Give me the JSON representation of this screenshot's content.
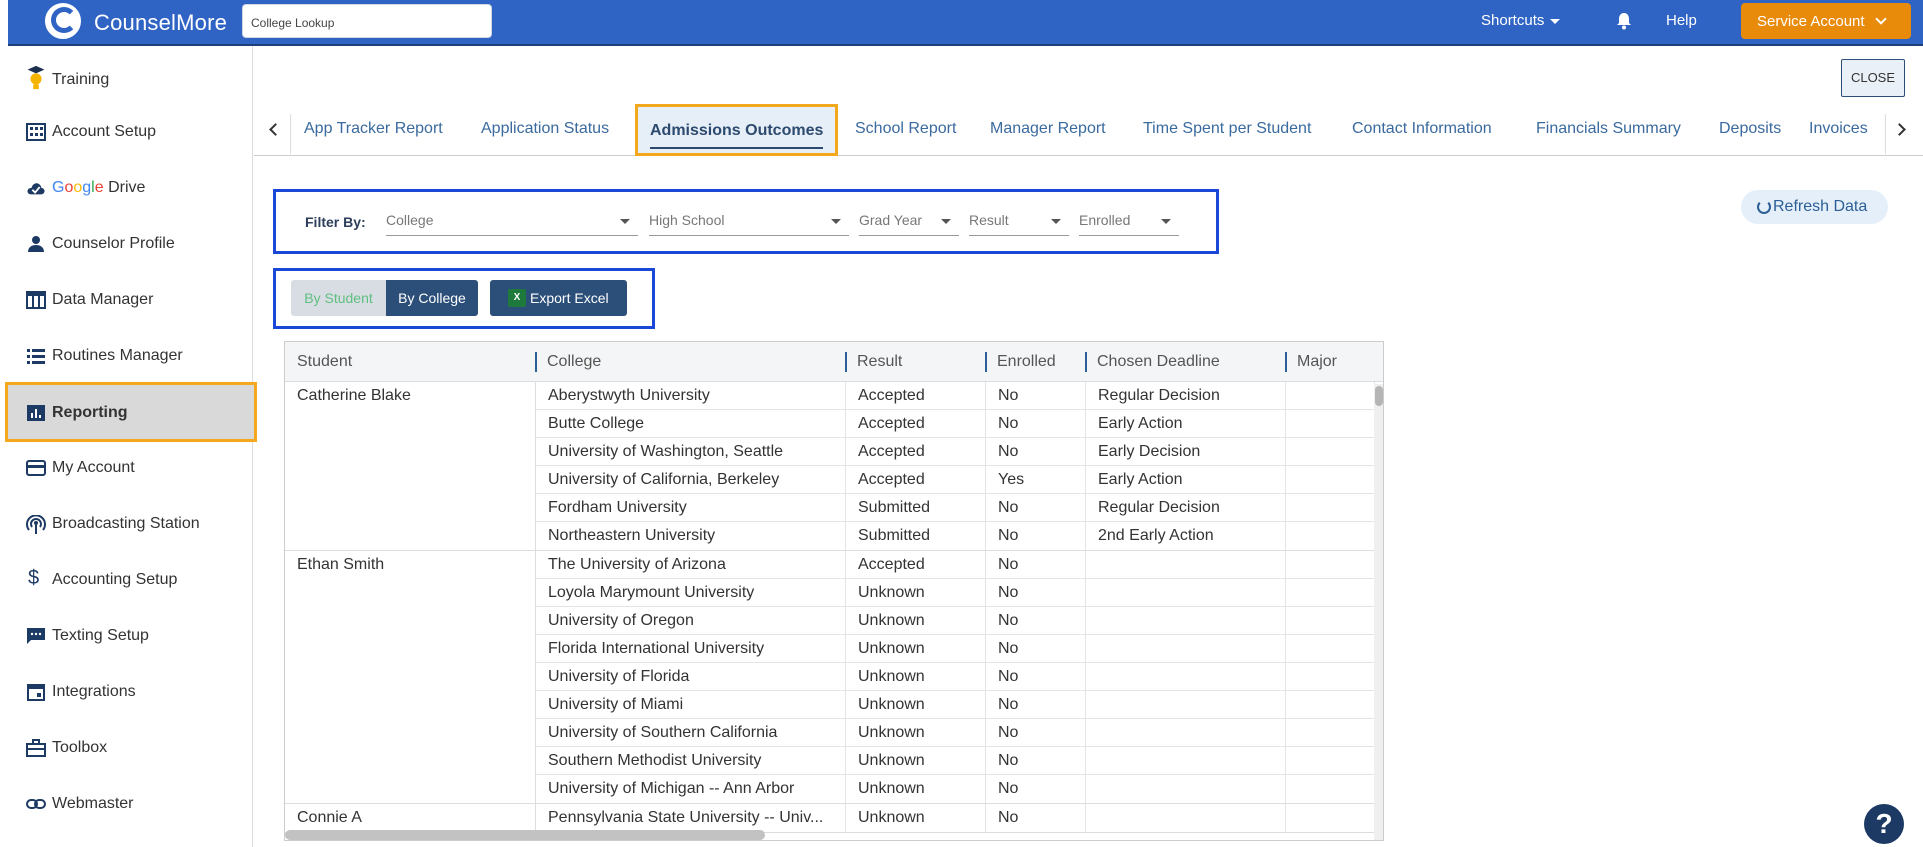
{
  "header": {
    "brand": "CounselMore",
    "search_value": "College Lookup",
    "shortcuts_label": "Shortcuts",
    "help_label": "Help",
    "account_label": "Service Account"
  },
  "sidebar": {
    "items": [
      {
        "label": "Training",
        "icon": "graduation-bulb-icon"
      },
      {
        "label": "Account Setup",
        "icon": "building-icon"
      },
      {
        "label": "Drive",
        "prefix": "Google",
        "icon": "cloud-check-icon"
      },
      {
        "label": "Counselor Profile",
        "icon": "person-icon"
      },
      {
        "label": "Data Manager",
        "icon": "table-icon"
      },
      {
        "label": "Routines Manager",
        "icon": "list-icon"
      },
      {
        "label": "Reporting",
        "icon": "bar-chart-icon",
        "active": true
      },
      {
        "label": "My Account",
        "icon": "credit-card-icon"
      },
      {
        "label": "Broadcasting Station",
        "icon": "broadcast-icon"
      },
      {
        "label": "Accounting Setup",
        "icon": "dollar-icon"
      },
      {
        "label": "Texting Setup",
        "icon": "chat-icon"
      },
      {
        "label": "Integrations",
        "icon": "calendar-icon"
      },
      {
        "label": "Toolbox",
        "icon": "toolbox-icon"
      },
      {
        "label": "Webmaster",
        "icon": "link-icon"
      }
    ]
  },
  "main": {
    "close_label": "CLOSE",
    "tabs": [
      {
        "label": "App Tracker Report"
      },
      {
        "label": "Application Status"
      },
      {
        "label": "Admissions Outcomes",
        "active": true
      },
      {
        "label": "School Report"
      },
      {
        "label": "Manager Report"
      },
      {
        "label": "Time Spent per Student"
      },
      {
        "label": "Contact Information"
      },
      {
        "label": "Financials Summary"
      },
      {
        "label": "Deposits"
      },
      {
        "label": "Invoices"
      }
    ],
    "filter": {
      "label": "Filter By:",
      "dropdowns": [
        {
          "placeholder": "College"
        },
        {
          "placeholder": "High School"
        },
        {
          "placeholder": "Grad Year"
        },
        {
          "placeholder": "Result"
        },
        {
          "placeholder": "Enrolled"
        }
      ]
    },
    "refresh_label": "Refresh Data",
    "view_toggle": {
      "by_student": "By Student",
      "by_college": "By College"
    },
    "export_label": "Export Excel"
  },
  "table": {
    "columns": [
      "Student",
      "College",
      "Result",
      "Enrolled",
      "Chosen Deadline",
      "Major"
    ],
    "groups": [
      {
        "student": "Catherine Blake",
        "rows": [
          {
            "college": "Aberystwyth University",
            "result": "Accepted",
            "enrolled": "No",
            "deadline": "Regular Decision",
            "major": ""
          },
          {
            "college": "Butte College",
            "result": "Accepted",
            "enrolled": "No",
            "deadline": "Early Action",
            "major": ""
          },
          {
            "college": "University of Washington, Seattle",
            "result": "Accepted",
            "enrolled": "No",
            "deadline": "Early Decision",
            "major": ""
          },
          {
            "college": "University of California, Berkeley",
            "result": "Accepted",
            "enrolled": "Yes",
            "deadline": "Early Action",
            "major": ""
          },
          {
            "college": "Fordham University",
            "result": "Submitted",
            "enrolled": "No",
            "deadline": "Regular Decision",
            "major": ""
          },
          {
            "college": "Northeastern University",
            "result": "Submitted",
            "enrolled": "No",
            "deadline": "2nd Early Action",
            "major": ""
          }
        ]
      },
      {
        "student": "Ethan Smith",
        "rows": [
          {
            "college": "The University of Arizona",
            "result": "Accepted",
            "enrolled": "No",
            "deadline": "",
            "major": ""
          },
          {
            "college": "Loyola Marymount University",
            "result": "Unknown",
            "enrolled": "No",
            "deadline": "",
            "major": ""
          },
          {
            "college": "University of Oregon",
            "result": "Unknown",
            "enrolled": "No",
            "deadline": "",
            "major": ""
          },
          {
            "college": "Florida International University",
            "result": "Unknown",
            "enrolled": "No",
            "deadline": "",
            "major": ""
          },
          {
            "college": "University of Florida",
            "result": "Unknown",
            "enrolled": "No",
            "deadline": "",
            "major": ""
          },
          {
            "college": "University of Miami",
            "result": "Unknown",
            "enrolled": "No",
            "deadline": "",
            "major": ""
          },
          {
            "college": "University of Southern California",
            "result": "Unknown",
            "enrolled": "No",
            "deadline": "",
            "major": ""
          },
          {
            "college": "Southern Methodist University",
            "result": "Unknown",
            "enrolled": "No",
            "deadline": "",
            "major": ""
          },
          {
            "college": "University of Michigan -- Ann Arbor",
            "result": "Unknown",
            "enrolled": "No",
            "deadline": "",
            "major": ""
          }
        ]
      },
      {
        "student": "Connie A",
        "rows": [
          {
            "college": "Pennsylvania State University -- Univ...",
            "result": "Unknown",
            "enrolled": "No",
            "deadline": "",
            "major": ""
          }
        ]
      }
    ]
  },
  "colors": {
    "topbar": "#2f64c4",
    "accent_orange": "#e88a0a",
    "highlight_orange": "#f4a81d",
    "highlight_blue": "#1a47d6",
    "button_navy": "#2c4f7a"
  }
}
